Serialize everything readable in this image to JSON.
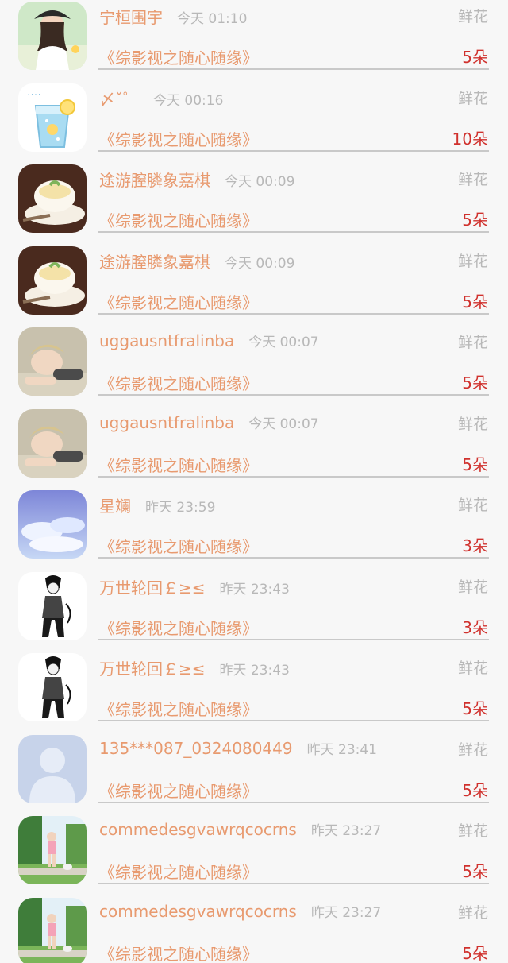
{
  "rows": [
    {
      "name": "宁桓围宇",
      "time": "今天 01:10",
      "gift": "鲜花",
      "book": "《综影视之随心随缘》",
      "count": "5朵",
      "avatar": "girl-hat-avatar"
    },
    {
      "name": "〆ˇ゜",
      "time": "今天 00:16",
      "gift": "鲜花",
      "book": "《综影视之随心随缘》",
      "count": "10朵",
      "avatar": "lemon-drink-avatar"
    },
    {
      "name": "途游膣膦象嘉棋",
      "time": "今天 00:09",
      "gift": "鲜花",
      "book": "《综影视之随心随缘》",
      "count": "5朵",
      "avatar": "pudding-avatar"
    },
    {
      "name": "途游膣膦象嘉棋",
      "time": "今天 00:09",
      "gift": "鲜花",
      "book": "《综影视之随心随缘》",
      "count": "5朵",
      "avatar": "pudding-avatar"
    },
    {
      "name": "uggausntfralinba",
      "time": "今天 00:07",
      "gift": "鲜花",
      "book": "《综影视之随心随缘》",
      "count": "5朵",
      "avatar": "lying-person-avatar"
    },
    {
      "name": "uggausntfralinba",
      "time": "今天 00:07",
      "gift": "鲜花",
      "book": "《综影视之随心随缘》",
      "count": "5朵",
      "avatar": "lying-person-avatar"
    },
    {
      "name": "星斓",
      "time": "昨天 23:59",
      "gift": "鲜花",
      "book": "《综影视之随心随缘》",
      "count": "3朵",
      "avatar": "sky-avatar"
    },
    {
      "name": "万世轮回￡≥≤",
      "time": "昨天 23:43",
      "gift": "鲜花",
      "book": "《综影视之随心随缘》",
      "count": "3朵",
      "avatar": "sketch-figure-avatar"
    },
    {
      "name": "万世轮回￡≥≤",
      "time": "昨天 23:43",
      "gift": "鲜花",
      "book": "《综影视之随心随缘》",
      "count": "5朵",
      "avatar": "sketch-figure-avatar"
    },
    {
      "name": "135***087_0324080449",
      "time": "昨天 23:41",
      "gift": "鲜花",
      "book": "《综影视之随心随缘》",
      "count": "5朵",
      "avatar": "default-user-avatar"
    },
    {
      "name": "commedesgvawrqcocrns",
      "time": "昨天 23:27",
      "gift": "鲜花",
      "book": "《综影视之随心随缘》",
      "count": "5朵",
      "avatar": "park-girl-avatar"
    },
    {
      "name": "commedesgvawrqcocrns",
      "time": "昨天 23:27",
      "gift": "鲜花",
      "book": "《综影视之随心随缘》",
      "count": "5朵",
      "avatar": "park-girl-avatar"
    }
  ],
  "colors": {
    "name": "#e89a6f",
    "time": "#b8b8b8",
    "count": "#d0312d",
    "divider": "#c9c9c9",
    "background": "#f7f7f7"
  }
}
